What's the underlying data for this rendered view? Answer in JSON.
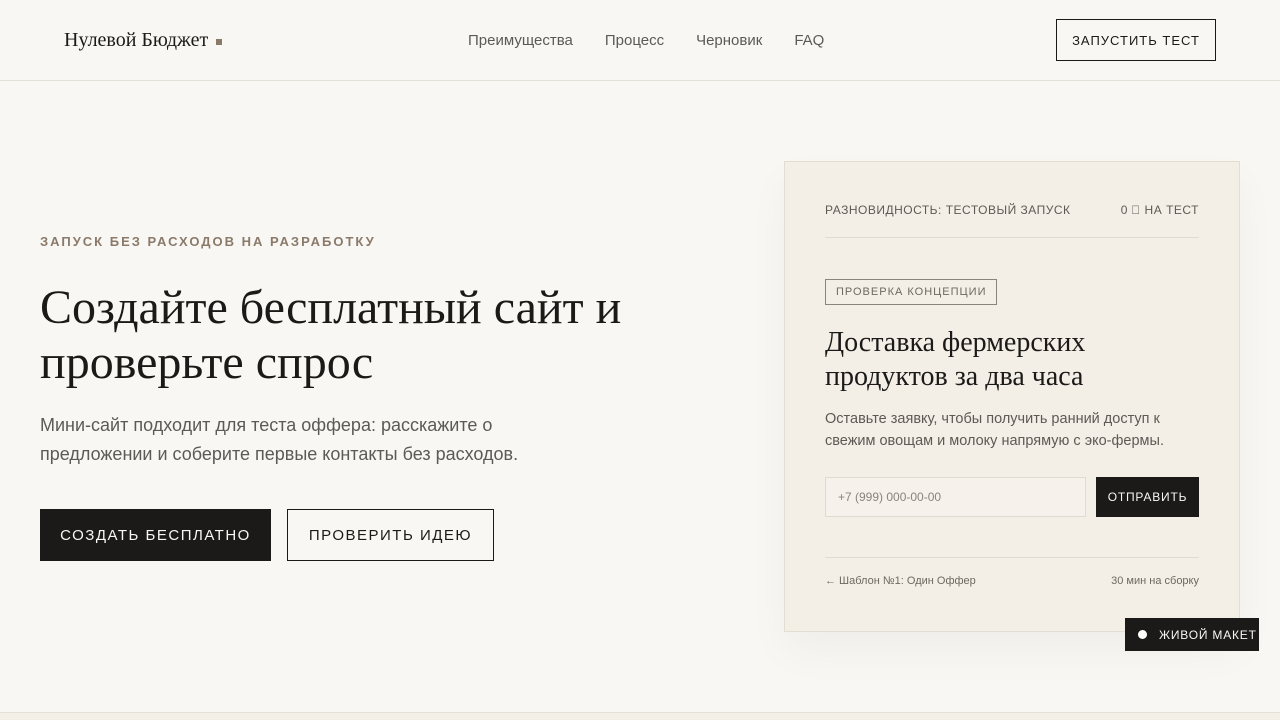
{
  "header": {
    "logo_text": "Нулевой Бюджет",
    "nav": [
      "Преимущества",
      "Процесс",
      "Черновик",
      "FAQ"
    ],
    "cta_label": "ЗАПУСТИТЬ ТЕСТ"
  },
  "hero": {
    "eyebrow": "ЗАПУСК БЕЗ РАСХОДОВ НА РАЗРАБОТКУ",
    "title": "Создайте бесплатный сайт и проверьте спрос",
    "lead": "Мини-сайт подходит для теста оффера: расскажите о предложении и соберите первые контакты без расходов.",
    "primary_button": "СОЗДАТЬ БЕСПЛАТНО",
    "secondary_button": "ПРОВЕРИТЬ ИДЕЮ"
  },
  "card": {
    "variant_label": "РАЗНОВИДНОСТЬ: ТЕСТОВЫЙ ЗАПУСК",
    "price_label": "0 ⃠ НА ТЕСТ",
    "tag": "ПРОВЕРКА КОНЦЕПЦИИ",
    "title": "Доставка фермерских продуктов за два часа",
    "text": "Оставьте заявку, чтобы получить ранний доступ к свежим овощам и молоку напрямую с эко-фермы.",
    "phone_placeholder": "+7 (999) 000-00-00",
    "phone_value": "",
    "submit_label": "ОТПРАВИТЬ",
    "template_link": "← Шаблон №1: Один Оффер",
    "build_time": "30 мин на сборку"
  },
  "live_badge": {
    "label": "ЖИВОЙ МАКЕТ"
  },
  "colors": {
    "background": "#f9f7f3",
    "card_background": "#f3efe7",
    "ink": "#1b1a18",
    "muted": "#5d5a55",
    "accent": "#8a7a6a"
  }
}
